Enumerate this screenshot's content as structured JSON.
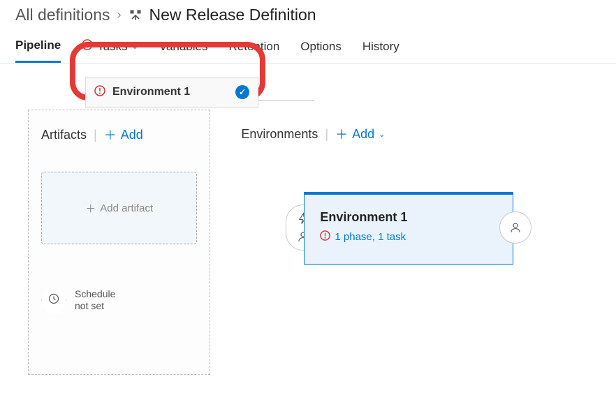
{
  "breadcrumb": {
    "root": "All definitions",
    "title": "New Release Definition"
  },
  "tabs": {
    "pipeline": "Pipeline",
    "tasks": "Tasks",
    "variables": "Variables",
    "retention": "Retention",
    "options": "Options",
    "history": "History"
  },
  "env_pill": {
    "label": "Environment 1"
  },
  "artifacts": {
    "title": "Artifacts",
    "add": "Add",
    "add_artifact": "Add artifact",
    "schedule": "Schedule\nnot set"
  },
  "environments": {
    "title": "Environments",
    "add": "Add",
    "card": {
      "name": "Environment 1",
      "phase_task": "1 phase, 1 task"
    }
  }
}
